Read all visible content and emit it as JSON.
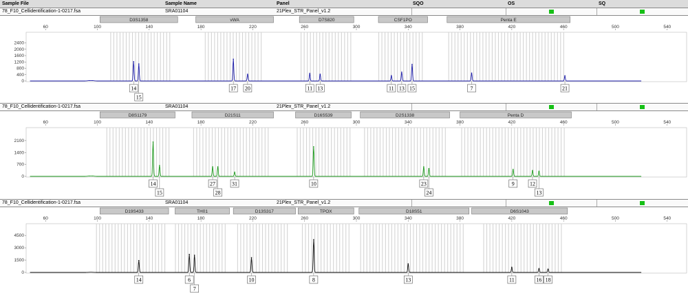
{
  "header": {
    "sample_file": "Sample File",
    "sample_name": "Sample Name",
    "panel": "Panel",
    "sqo": "SQO",
    "os": "OS",
    "sq": "SQ"
  },
  "qc_color": "#16c016",
  "chart_data": [
    {
      "type": "line",
      "sample_file": "78_F10_Cellidentification-1-0217.fsa",
      "sample_name": "SRA01104",
      "panel": "21Plex_STR_Panel_v1.2",
      "color": "#1a1aa8",
      "x_ticks": [
        60,
        100,
        140,
        180,
        220,
        260,
        300,
        340,
        380,
        420,
        460,
        500,
        540
      ],
      "xlim": [
        45,
        555
      ],
      "y_ticks": [
        0,
        400,
        800,
        1200,
        1600,
        2000,
        2400
      ],
      "ylim": [
        0,
        2900
      ],
      "loci": [
        {
          "name": "D3S1358",
          "start": 102,
          "end": 162
        },
        {
          "name": "vWA",
          "start": 176,
          "end": 236
        },
        {
          "name": "D7S820",
          "start": 256,
          "end": 298
        },
        {
          "name": "CSF1PO",
          "start": 317,
          "end": 355
        },
        {
          "name": "Penta E",
          "start": 370,
          "end": 465
        }
      ],
      "bins": [
        [
          110,
          156
        ],
        [
          183,
          228
        ],
        [
          257,
          296
        ],
        [
          317,
          352
        ],
        [
          371,
          462
        ]
      ],
      "peaks": [
        {
          "x": 128,
          "y": 1220,
          "allele": "14",
          "row": 0
        },
        {
          "x": 132,
          "y": 1080,
          "allele": "15",
          "row": 1
        },
        {
          "x": 205,
          "y": 1380,
          "allele": "17",
          "row": 0
        },
        {
          "x": 216,
          "y": 430,
          "allele": "20",
          "row": 0
        },
        {
          "x": 264,
          "y": 480,
          "allele": "11",
          "row": 0
        },
        {
          "x": 272,
          "y": 430,
          "allele": "13",
          "row": 0
        },
        {
          "x": 327,
          "y": 340,
          "allele": "11",
          "row": 0
        },
        {
          "x": 335,
          "y": 560,
          "allele": "13",
          "row": 0
        },
        {
          "x": 343,
          "y": 1050,
          "allele": "15",
          "row": 0
        },
        {
          "x": 389,
          "y": 500,
          "allele": "7",
          "row": 0
        },
        {
          "x": 461,
          "y": 320,
          "allele": "21",
          "row": 0
        }
      ]
    },
    {
      "type": "line",
      "sample_file": "78_F10_Cellidentification-1-0217.fsa",
      "sample_name": "SRA01104",
      "panel": "21Plex_STR_Panel_v1.2",
      "color": "#1c9a1c",
      "x_ticks": [
        60,
        100,
        140,
        180,
        220,
        260,
        300,
        340,
        380,
        420,
        460,
        500,
        540
      ],
      "xlim": [
        45,
        555
      ],
      "y_ticks": [
        0,
        700,
        1400,
        2100
      ],
      "ylim": [
        0,
        2700
      ],
      "loci": [
        {
          "name": "D8S1179",
          "start": 102,
          "end": 160
        },
        {
          "name": "D21S11",
          "start": 173,
          "end": 236
        },
        {
          "name": "D16S539",
          "start": 253,
          "end": 296
        },
        {
          "name": "D2S1338",
          "start": 303,
          "end": 372
        },
        {
          "name": "Penta D",
          "start": 380,
          "end": 466
        }
      ],
      "bins": [
        [
          107,
          156
        ],
        [
          174,
          234
        ],
        [
          254,
          296
        ],
        [
          306,
          370
        ],
        [
          381,
          462
        ]
      ],
      "peaks": [
        {
          "x": 143,
          "y": 2020,
          "allele": "14",
          "row": 0
        },
        {
          "x": 148,
          "y": 640,
          "allele": "15",
          "row": 1
        },
        {
          "x": 189,
          "y": 560,
          "allele": "27",
          "row": 0
        },
        {
          "x": 193,
          "y": 560,
          "allele": "28",
          "row": 1
        },
        {
          "x": 206,
          "y": 240,
          "allele": "31",
          "row": 0
        },
        {
          "x": 267,
          "y": 1740,
          "allele": "10",
          "row": 0
        },
        {
          "x": 352,
          "y": 560,
          "allele": "23",
          "row": 0
        },
        {
          "x": 356,
          "y": 460,
          "allele": "24",
          "row": 1
        },
        {
          "x": 421,
          "y": 410,
          "allele": "9",
          "row": 0
        },
        {
          "x": 436,
          "y": 340,
          "allele": "12",
          "row": 0
        },
        {
          "x": 441,
          "y": 300,
          "allele": "13",
          "row": 1
        }
      ]
    },
    {
      "type": "line",
      "sample_file": "78_F10_Cellidentification-1-0217.fsa",
      "sample_name": "SRA01104",
      "panel": "21Plex_STR_Panel_v1.2",
      "color": "#111111",
      "x_ticks": [
        60,
        100,
        140,
        180,
        220,
        260,
        300,
        340,
        380,
        420,
        460,
        500,
        540
      ],
      "xlim": [
        45,
        555
      ],
      "y_ticks": [
        0,
        1500,
        3000,
        4500
      ],
      "ylim": [
        0,
        5600
      ],
      "loci": [
        {
          "name": "D19S433",
          "start": 102,
          "end": 155
        },
        {
          "name": "TH01",
          "start": 160,
          "end": 202
        },
        {
          "name": "D13S317",
          "start": 205,
          "end": 253
        },
        {
          "name": "TPOX",
          "start": 255,
          "end": 298
        },
        {
          "name": "D18S51",
          "start": 302,
          "end": 387
        },
        {
          "name": "D6S1043",
          "start": 389,
          "end": 463
        }
      ],
      "bins": [
        [
          99,
          152
        ],
        [
          160,
          200
        ],
        [
          208,
          248
        ],
        [
          258,
          296
        ],
        [
          303,
          384
        ],
        [
          398,
          459
        ]
      ],
      "peaks": [
        {
          "x": 132,
          "y": 1450,
          "allele": "14",
          "row": 0
        },
        {
          "x": 171,
          "y": 2200,
          "allele": "6",
          "row": 0
        },
        {
          "x": 175,
          "y": 2100,
          "allele": "7",
          "row": 1
        },
        {
          "x": 219,
          "y": 1800,
          "allele": "10",
          "row": 0
        },
        {
          "x": 267,
          "y": 4000,
          "allele": "8",
          "row": 0
        },
        {
          "x": 340,
          "y": 1050,
          "allele": "13",
          "row": 0
        },
        {
          "x": 420,
          "y": 620,
          "allele": "11",
          "row": 0
        },
        {
          "x": 441,
          "y": 470,
          "allele": "16",
          "row": 0
        },
        {
          "x": 448,
          "y": 400,
          "allele": "18",
          "row": 0
        }
      ]
    }
  ]
}
